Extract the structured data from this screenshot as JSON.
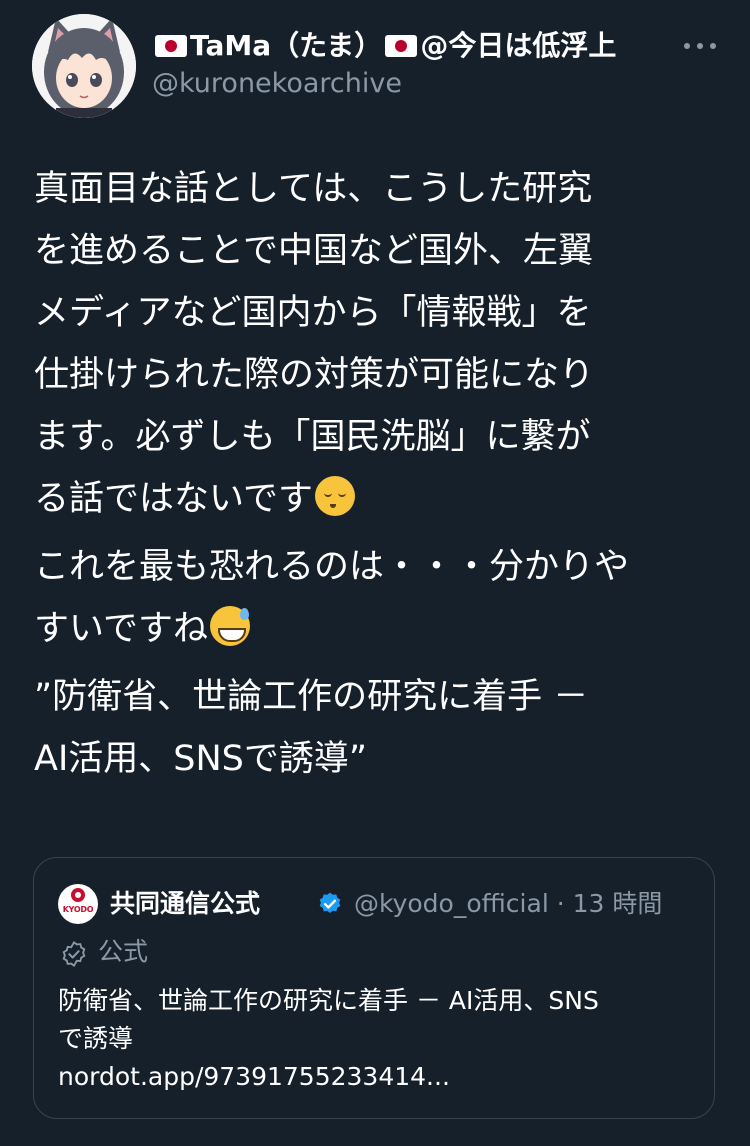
{
  "author": {
    "name_before_flag": "",
    "name_part1": "TaMa（たま）",
    "name_part2": "@今日は低浮上",
    "handle": "@kuronekoarchive"
  },
  "tweet": {
    "paragraph1": "真面目な話としては、こうした研究\nを進めることで中国など国外、左翼\nメディアなど国内から「情報戦」を\n仕掛けられた際の対策が可能になり\nます。必ずしも「国民洗脳」に繋が\nる話ではないです",
    "paragraph2": "これを最も恐れるのは・・・分かりや\nすいですね",
    "paragraph3": "”防衛省、世論工作の研究に着手 －\nAI活用、SNSで誘導”",
    "emoji1": "relieved-face",
    "emoji2": "grinning-face-with-sweat"
  },
  "quoted": {
    "avatar_text": "KYODO",
    "name": "共同通信公式",
    "meta": "@kyodo_official · 13 時間",
    "official_label": "公式",
    "text_line1": "防衛省、世論工作の研究に着手 － AI活用、SNS",
    "text_line2": "で誘導",
    "text_line3": "nordot.app/97391755233414..."
  },
  "colors": {
    "background": "#15202b",
    "secondary_text": "#8b98a5",
    "border": "#38444d",
    "verified_blue": "#1d9bf0"
  }
}
